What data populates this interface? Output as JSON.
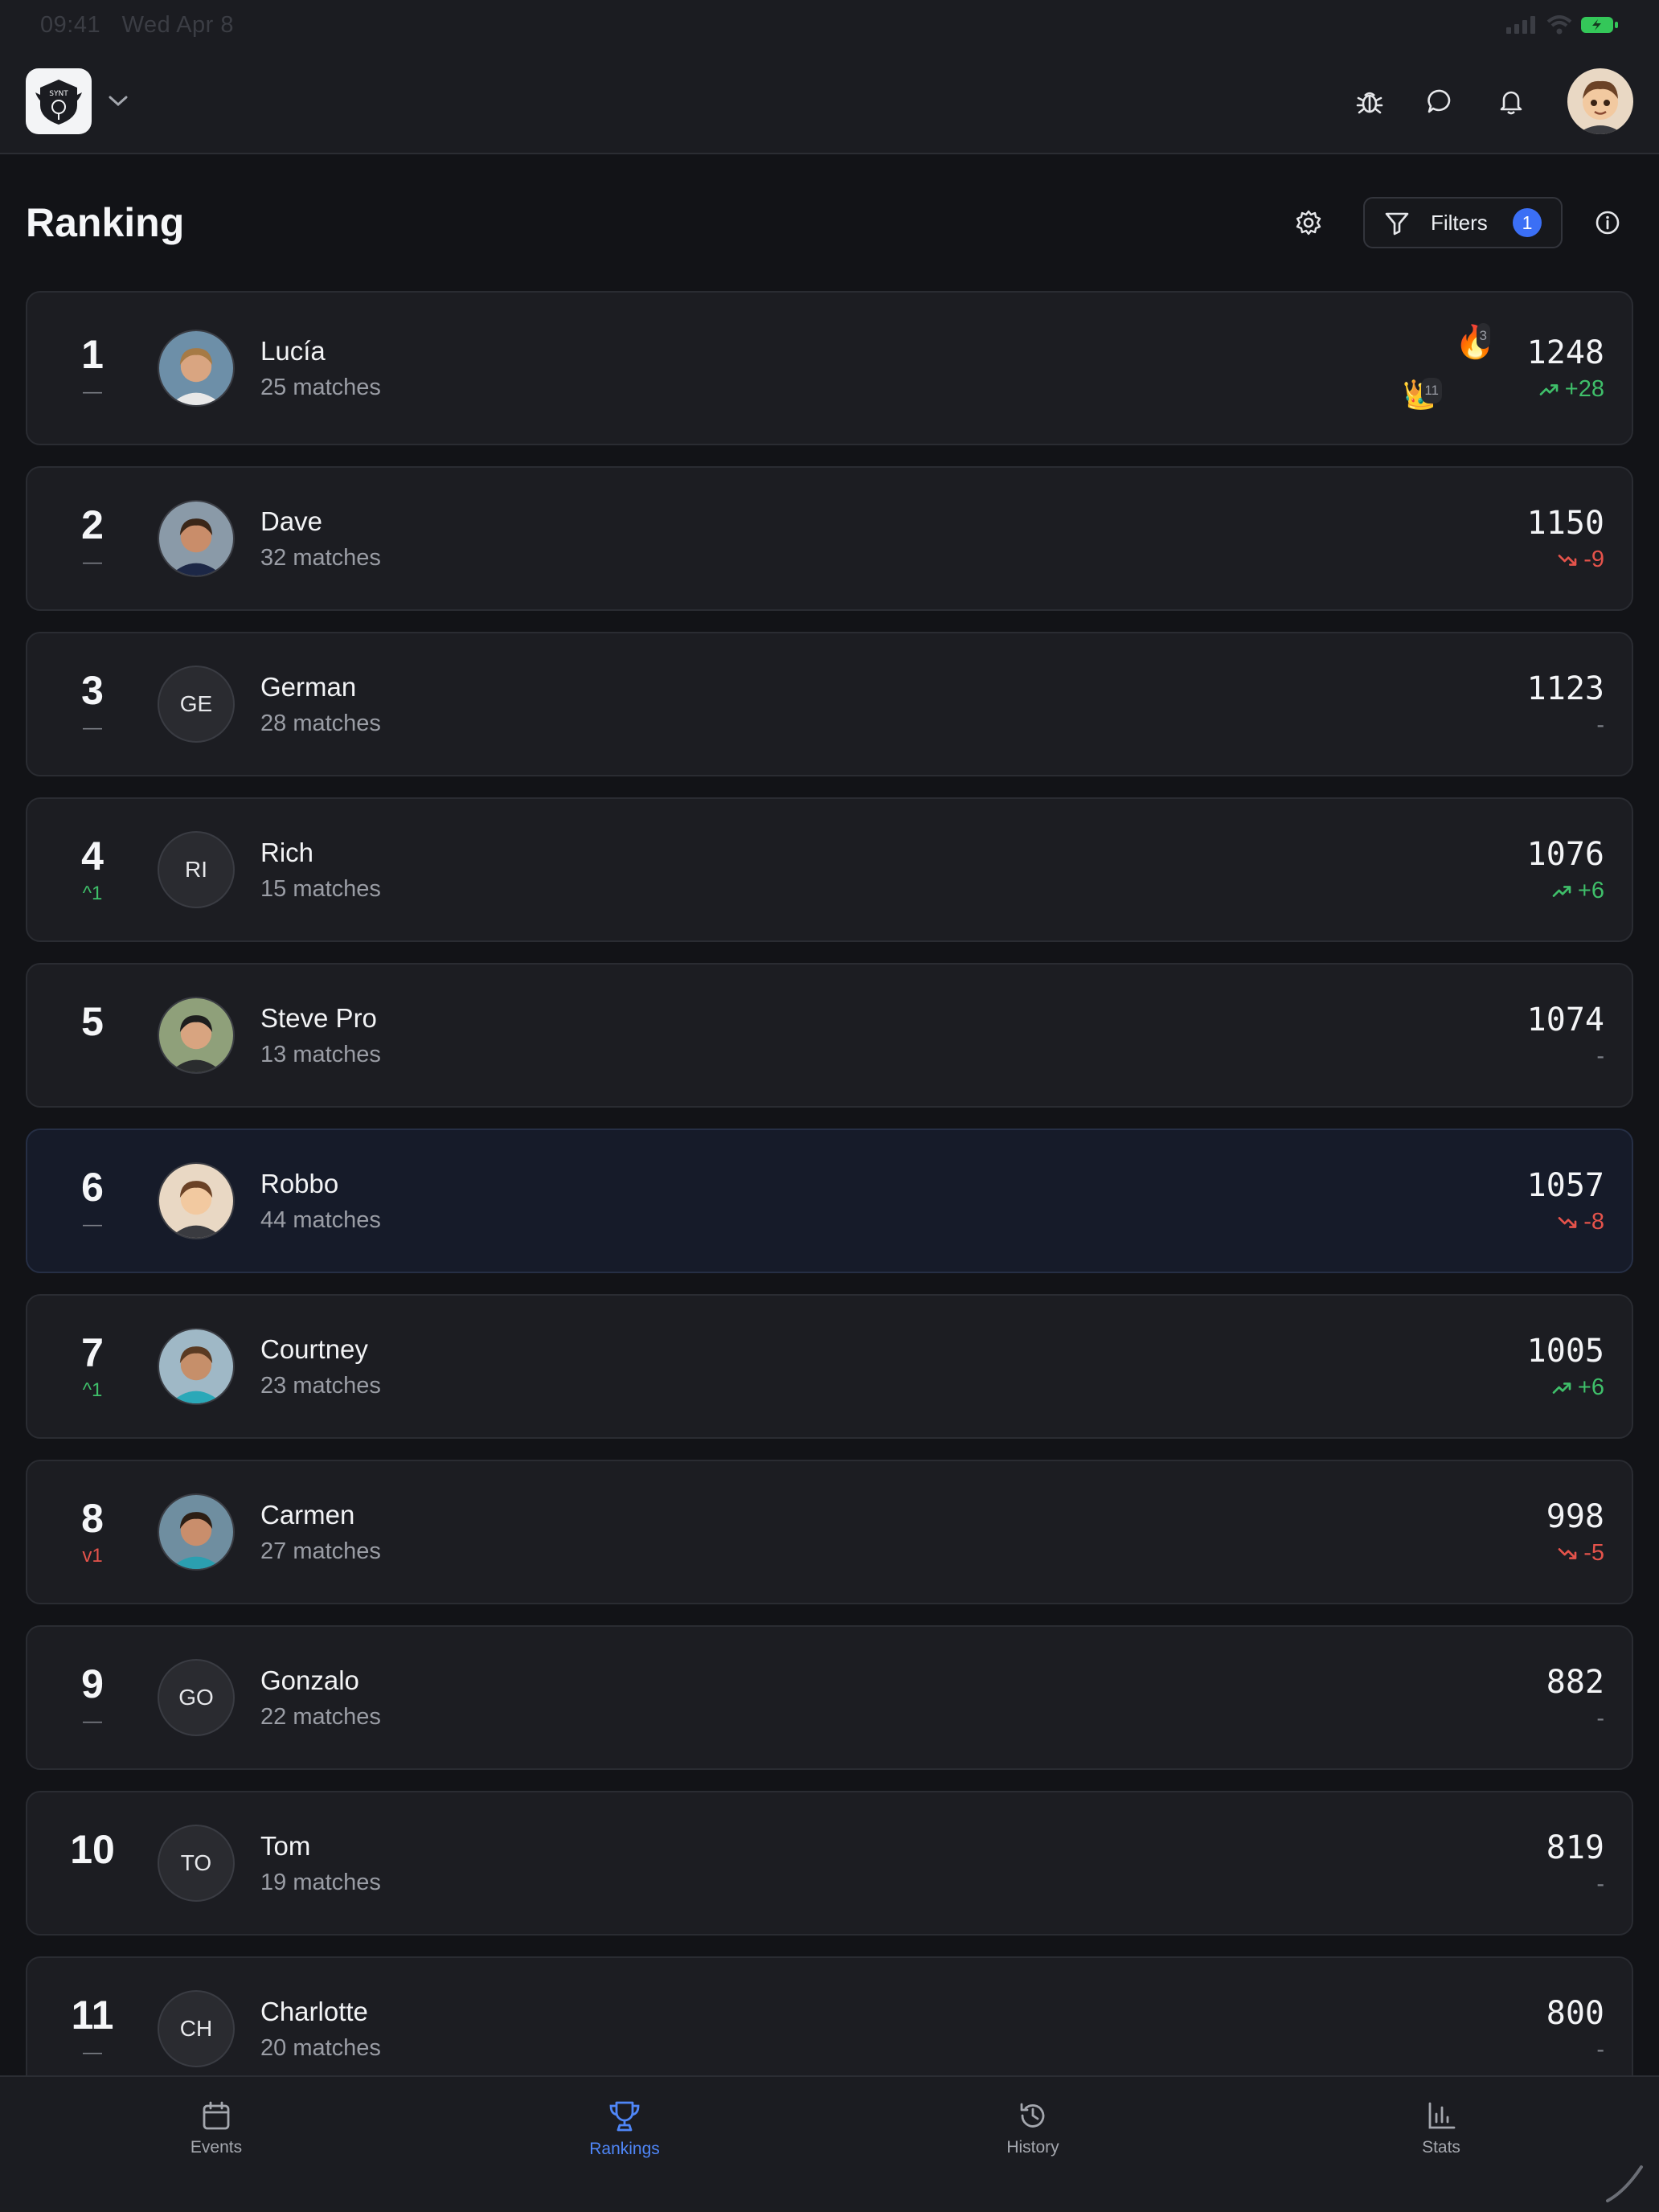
{
  "status_bar": {
    "time": "09:41",
    "date": "Wed Apr 8"
  },
  "app_bar": {
    "logo_text": "SYNT"
  },
  "page": {
    "title": "Ranking"
  },
  "filters": {
    "label": "Filters",
    "count": "1"
  },
  "players": [
    {
      "rank": "1",
      "movement": "—",
      "movement_dir": "same",
      "name": "Lucía",
      "matches": "25 matches",
      "avatar": "photo",
      "initials": "",
      "elo": "1248",
      "delta": "+28",
      "delta_dir": "up",
      "badges": [
        {
          "icon": "🔥",
          "count": "3"
        },
        {
          "icon": "👑",
          "count": "11"
        }
      ]
    },
    {
      "rank": "2",
      "movement": "—",
      "movement_dir": "same",
      "name": "Dave",
      "matches": "32 matches",
      "avatar": "photo",
      "initials": "",
      "elo": "1150",
      "delta": "-9",
      "delta_dir": "down"
    },
    {
      "rank": "3",
      "movement": "—",
      "movement_dir": "same",
      "name": "German",
      "matches": "28 matches",
      "avatar": "initials",
      "initials": "GE",
      "elo": "1123",
      "delta": "-",
      "delta_dir": "same"
    },
    {
      "rank": "4",
      "movement": "^1",
      "movement_dir": "up",
      "name": "Rich",
      "matches": "15 matches",
      "avatar": "initials",
      "initials": "RI",
      "elo": "1076",
      "delta": "+6",
      "delta_dir": "up"
    },
    {
      "rank": "5",
      "movement": "",
      "movement_dir": "same",
      "name": "Steve Pro",
      "matches": "13 matches",
      "avatar": "photo",
      "initials": "",
      "elo": "1074",
      "delta": "-",
      "delta_dir": "same"
    },
    {
      "rank": "6",
      "movement": "—",
      "movement_dir": "same",
      "name": "Robbo",
      "matches": "44 matches",
      "avatar": "photo",
      "initials": "",
      "elo": "1057",
      "delta": "-8",
      "delta_dir": "down",
      "is_me": true
    },
    {
      "rank": "7",
      "movement": "^1",
      "movement_dir": "up",
      "name": "Courtney",
      "matches": "23 matches",
      "avatar": "photo",
      "initials": "",
      "elo": "1005",
      "delta": "+6",
      "delta_dir": "up"
    },
    {
      "rank": "8",
      "movement": "v1",
      "movement_dir": "down",
      "name": "Carmen",
      "matches": "27 matches",
      "avatar": "photo",
      "initials": "",
      "elo": "998",
      "delta": "-5",
      "delta_dir": "down"
    },
    {
      "rank": "9",
      "movement": "—",
      "movement_dir": "same",
      "name": "Gonzalo",
      "matches": "22 matches",
      "avatar": "initials",
      "initials": "GO",
      "elo": "882",
      "delta": "-",
      "delta_dir": "same"
    },
    {
      "rank": "10",
      "movement": "",
      "movement_dir": "same",
      "name": "Tom",
      "matches": "19 matches",
      "avatar": "initials",
      "initials": "TO",
      "elo": "819",
      "delta": "-",
      "delta_dir": "same"
    },
    {
      "rank": "11",
      "movement": "—",
      "movement_dir": "same",
      "name": "Charlotte",
      "matches": "20 matches",
      "avatar": "initials",
      "initials": "CH",
      "elo": "800",
      "delta": "-",
      "delta_dir": "same"
    }
  ],
  "tabs": [
    {
      "label": "Events",
      "icon": "calendar-icon",
      "active": false
    },
    {
      "label": "Rankings",
      "icon": "trophy-icon",
      "active": true
    },
    {
      "label": "History",
      "icon": "history-icon",
      "active": false
    },
    {
      "label": "Stats",
      "icon": "bar-chart-icon",
      "active": false
    }
  ],
  "colors": {
    "accent": "#4f86f7",
    "up": "#3fbf6a",
    "down": "#e5534b",
    "background": "#121317",
    "card": "#1c1d22"
  }
}
